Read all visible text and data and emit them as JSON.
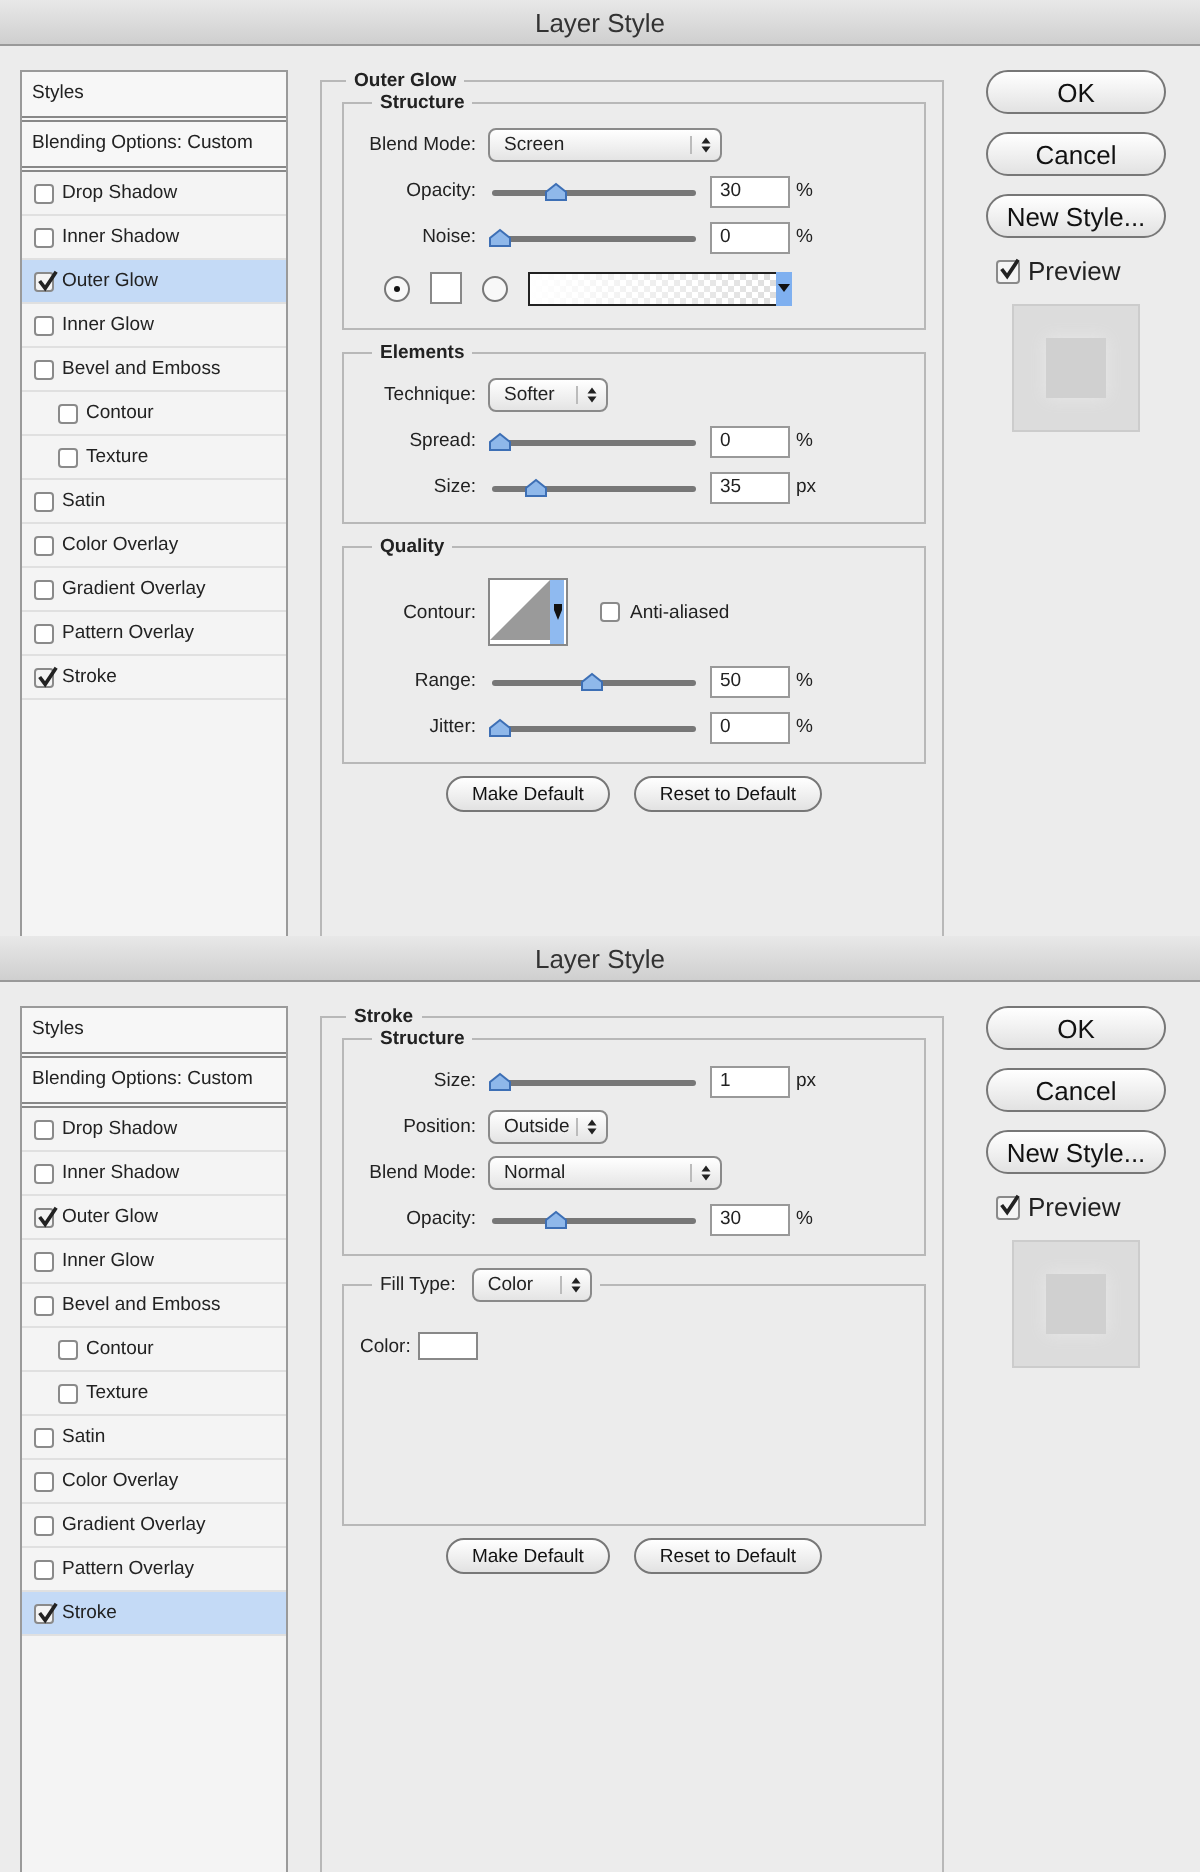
{
  "dialogs": [
    {
      "title": "Layer Style",
      "styles": {
        "header": "Styles",
        "blending": "Blending Options: Custom",
        "items": [
          {
            "label": "Drop Shadow",
            "checked": false,
            "selected": false
          },
          {
            "label": "Inner Shadow",
            "checked": false,
            "selected": false
          },
          {
            "label": "Outer Glow",
            "checked": true,
            "selected": true
          },
          {
            "label": "Inner Glow",
            "checked": false,
            "selected": false
          },
          {
            "label": "Bevel and Emboss",
            "checked": false,
            "selected": false,
            "children": [
              {
                "label": "Contour",
                "checked": false,
                "selected": false
              },
              {
                "label": "Texture",
                "checked": false,
                "selected": false
              }
            ]
          },
          {
            "label": "Satin",
            "checked": false,
            "selected": false
          },
          {
            "label": "Color Overlay",
            "checked": false,
            "selected": false
          },
          {
            "label": "Gradient Overlay",
            "checked": false,
            "selected": false
          },
          {
            "label": "Pattern Overlay",
            "checked": false,
            "selected": false
          },
          {
            "label": "Stroke",
            "checked": true,
            "selected": false
          }
        ]
      },
      "panel": {
        "title": "Outer Glow",
        "groups": [
          {
            "title": "Structure",
            "rows": [
              {
                "kind": "wide-select",
                "label": "Blend Mode:",
                "value": "Screen"
              },
              {
                "kind": "slider",
                "label": "Opacity:",
                "level": 0.3,
                "value": "30",
                "unit": "%"
              },
              {
                "kind": "slider",
                "label": "Noise:",
                "level": 0,
                "value": "0",
                "unit": "%"
              },
              {
                "kind": "fill",
                "options": [
                  {
                    "kind": "solid",
                    "selected": true
                  },
                  {
                    "kind": "gradient",
                    "selected": false
                  }
                ]
              }
            ]
          },
          {
            "title": "Elements",
            "rows": [
              {
                "kind": "select",
                "label": "Technique:",
                "value": "Softer"
              },
              {
                "kind": "slider",
                "label": "Spread:",
                "level": 0,
                "value": "0",
                "unit": "%"
              },
              {
                "kind": "slider",
                "label": "Size:",
                "level": 0.2,
                "value": "35",
                "unit": "px"
              }
            ]
          },
          {
            "title": "Quality",
            "rows": [
              {
                "kind": "contour",
                "label": "Contour:",
                "checkbox": "Anti-aliased",
                "checked": false
              },
              {
                "kind": "slider",
                "label": "Range:",
                "level": 0.5,
                "value": "50",
                "unit": "%"
              },
              {
                "kind": "slider",
                "label": "Jitter:",
                "level": 0,
                "value": "0",
                "unit": "%"
              }
            ]
          }
        ],
        "buttons": [
          "Make Default",
          "Reset to Default"
        ]
      },
      "buttons": [
        "OK",
        "Cancel",
        "New Style..."
      ],
      "preview": {
        "label": "Preview",
        "checked": true
      }
    },
    {
      "title": "Layer Style",
      "styles": {
        "header": "Styles",
        "blending": "Blending Options: Custom",
        "items": [
          {
            "label": "Drop Shadow",
            "checked": false,
            "selected": false
          },
          {
            "label": "Inner Shadow",
            "checked": false,
            "selected": false
          },
          {
            "label": "Outer Glow",
            "checked": true,
            "selected": false
          },
          {
            "label": "Inner Glow",
            "checked": false,
            "selected": false
          },
          {
            "label": "Bevel and Emboss",
            "checked": false,
            "selected": false,
            "children": [
              {
                "label": "Contour",
                "checked": false,
                "selected": false
              },
              {
                "label": "Texture",
                "checked": false,
                "selected": false
              }
            ]
          },
          {
            "label": "Satin",
            "checked": false,
            "selected": false
          },
          {
            "label": "Color Overlay",
            "checked": false,
            "selected": false
          },
          {
            "label": "Gradient Overlay",
            "checked": false,
            "selected": false
          },
          {
            "label": "Pattern Overlay",
            "checked": false,
            "selected": false
          },
          {
            "label": "Stroke",
            "checked": true,
            "selected": true
          }
        ]
      },
      "panel": {
        "title": "Stroke",
        "groups": [
          {
            "title": "Structure",
            "rows": [
              {
                "kind": "slider",
                "label": "Size:",
                "level": 0,
                "value": "1",
                "unit": "px"
              },
              {
                "kind": "select",
                "label": "Position:",
                "value": "Outside"
              },
              {
                "kind": "wide-select",
                "label": "Blend Mode:",
                "value": "Normal"
              },
              {
                "kind": "slider",
                "label": "Opacity:",
                "level": 0.3,
                "value": "30",
                "unit": "%"
              }
            ]
          },
          {
            "title": "Fill Type:",
            "select": "Color",
            "rows": [
              {
                "kind": "swatch",
                "label": "Color:"
              }
            ]
          }
        ],
        "buttons": [
          "Make Default",
          "Reset to Default"
        ]
      },
      "buttons": [
        "OK",
        "Cancel",
        "New Style..."
      ],
      "preview": {
        "label": "Preview",
        "checked": true
      }
    }
  ]
}
